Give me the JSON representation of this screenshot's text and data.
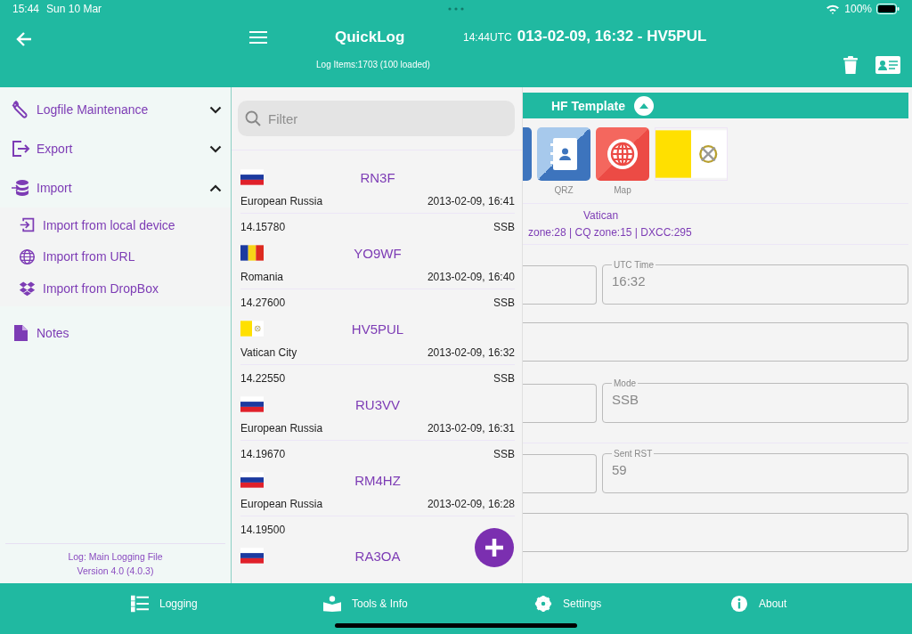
{
  "status_bar": {
    "time": "15:44",
    "date": "Sun 10 Mar",
    "battery": "100%"
  },
  "header": {
    "title": "QuickLog",
    "log_items": "Log Items:1703 (100 loaded)",
    "utc": "14:44UTC",
    "contact_title": "013-02-09, 16:32 - HV5PUL"
  },
  "sidebar": {
    "items": [
      {
        "label": "Logfile Maintenance",
        "expanded": false
      },
      {
        "label": "Export",
        "expanded": false
      },
      {
        "label": "Import",
        "expanded": true,
        "children": [
          {
            "label": "Import from local device"
          },
          {
            "label": "Import from URL"
          },
          {
            "label": "Import from DropBox"
          }
        ]
      },
      {
        "label": "Notes"
      }
    ],
    "footer": [
      "Log: Main Logging File",
      "Version 4.0 (4.0.3)"
    ]
  },
  "log_list": {
    "filter_placeholder": "Filter",
    "entries": [
      {
        "kind": "ru",
        "callsign": "RN3F",
        "country": "European Russia",
        "datetime": "2013-02-09, 16:41",
        "frequency": "14.15780",
        "mode": "SSB"
      },
      {
        "kind": "ro",
        "callsign": "YO9WF",
        "country": "Romania",
        "datetime": "2013-02-09, 16:40",
        "frequency": "14.27600",
        "mode": "SSB"
      },
      {
        "kind": "va",
        "callsign": "HV5PUL",
        "country": "Vatican City",
        "datetime": "2013-02-09, 16:32",
        "frequency": "14.22550",
        "mode": "SSB"
      },
      {
        "kind": "ru",
        "callsign": "RU3VV",
        "country": "European Russia",
        "datetime": "2013-02-09, 16:31",
        "frequency": "14.19670",
        "mode": "SSB"
      },
      {
        "kind": "ru",
        "callsign": "RM4HZ",
        "country": "European Russia",
        "datetime": "2013-02-09, 16:28",
        "frequency": "14.19500"
      },
      {
        "kind": "ru",
        "callsign": "RA3OA"
      }
    ]
  },
  "detail": {
    "template": {
      "label": "HF Template",
      "expanded": true
    },
    "tiles": [
      {
        "label": "QRZ"
      },
      {
        "label": "Map"
      }
    ],
    "country": "Vatican",
    "zones": "zone:28 | CQ zone:15 | DXCC:295",
    "fields": [
      {
        "label": "UTC Time",
        "value": "16:32"
      },
      {
        "label": "Mode",
        "value": "SSB"
      },
      {
        "label": "Sent RST",
        "value": "59"
      }
    ]
  },
  "tabs": [
    {
      "label": "Logging"
    },
    {
      "label": "Tools & Info"
    },
    {
      "label": "Settings"
    },
    {
      "label": "About"
    }
  ]
}
